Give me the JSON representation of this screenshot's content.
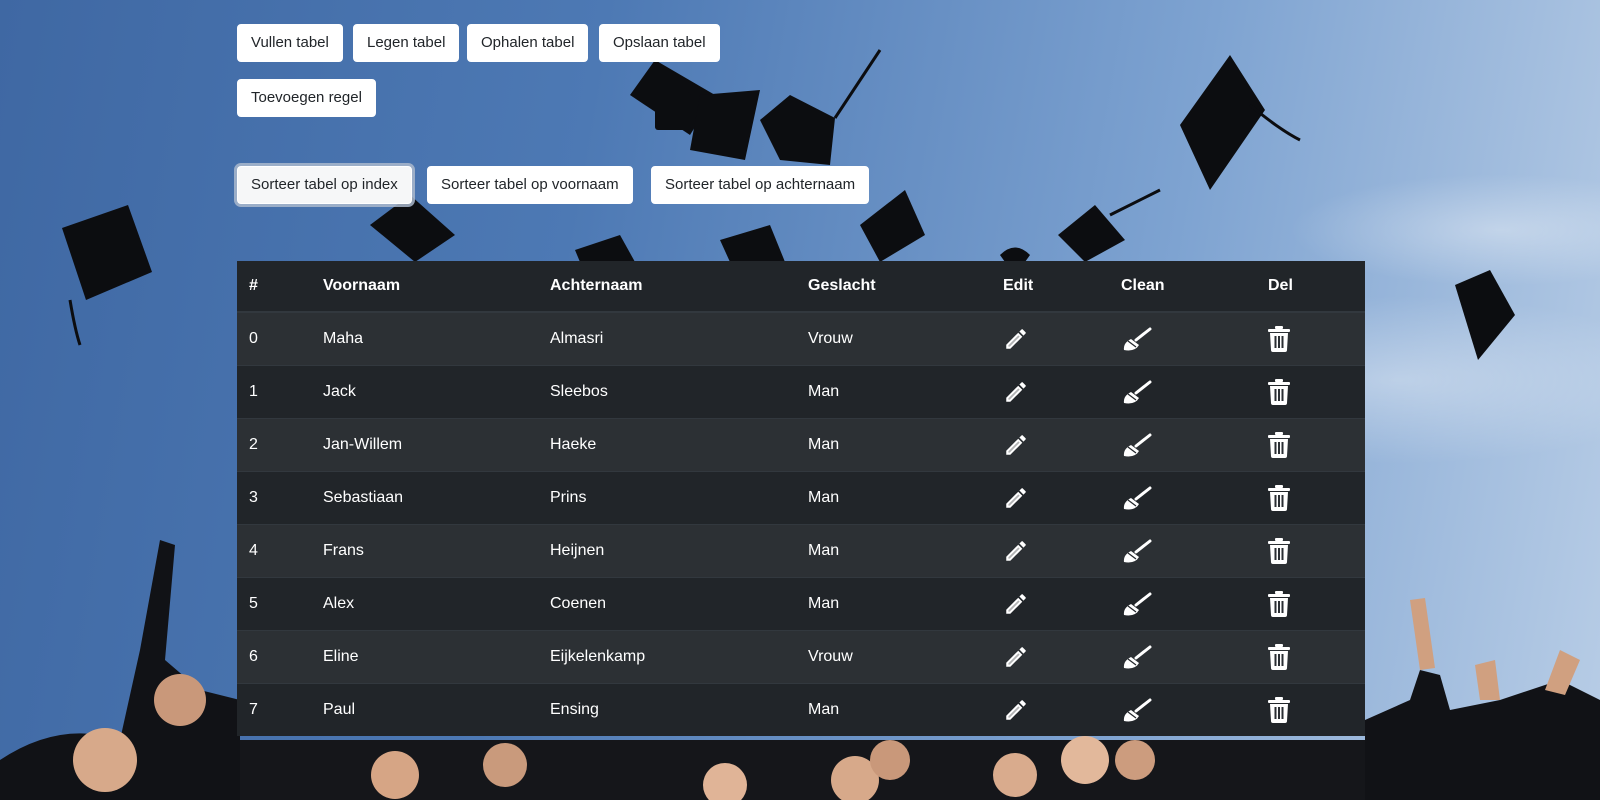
{
  "toolbar": {
    "row1": [
      "Vullen tabel",
      "Legen tabel",
      "Ophalen tabel",
      "Opslaan tabel"
    ],
    "row2": [
      "Toevoegen regel"
    ],
    "sort": [
      "Sorteer tabel op index",
      "Sorteer tabel op voornaam",
      "Sorteer tabel op achternaam"
    ]
  },
  "table": {
    "headers": [
      "#",
      "Voornaam",
      "Achternaam",
      "Geslacht",
      "Edit",
      "Clean",
      "Del"
    ],
    "rows": [
      {
        "index": "0",
        "first": "Maha",
        "last": "Almasri",
        "gender": "Vrouw"
      },
      {
        "index": "1",
        "first": "Jack",
        "last": "Sleebos",
        "gender": "Man"
      },
      {
        "index": "2",
        "first": "Jan-Willem",
        "last": "Haeke",
        "gender": "Man"
      },
      {
        "index": "3",
        "first": "Sebastiaan",
        "last": "Prins",
        "gender": "Man"
      },
      {
        "index": "4",
        "first": "Frans",
        "last": "Heijnen",
        "gender": "Man"
      },
      {
        "index": "5",
        "first": "Alex",
        "last": "Coenen",
        "gender": "Man"
      },
      {
        "index": "6",
        "first": "Eline",
        "last": "Eijkelenkamp",
        "gender": "Vrouw"
      },
      {
        "index": "7",
        "first": "Paul",
        "last": "Ensing",
        "gender": "Man"
      }
    ],
    "row_icons": [
      "pencil-icon",
      "broom-icon",
      "trash-icon"
    ]
  },
  "colors": {
    "table_header": "#212529",
    "row_odd": "#2c3034",
    "row_even": "#212529",
    "button_bg": "#ffffff",
    "sky": "#4d79b4"
  }
}
